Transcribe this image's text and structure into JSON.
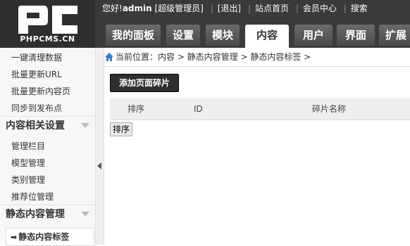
{
  "logo": {
    "text": "PHPCMS.CN"
  },
  "topbar": {
    "greeting": "您好!",
    "username": "admin",
    "role": "[超级管理员]",
    "logout": "[退出]",
    "site_home": "站点首页",
    "member_center": "会员中心",
    "search": "搜索"
  },
  "nav": {
    "tabs": [
      {
        "label": "我的面板"
      },
      {
        "label": "设置"
      },
      {
        "label": "模块"
      },
      {
        "label": "内容",
        "active": true
      },
      {
        "label": "用户"
      },
      {
        "label": "界面"
      },
      {
        "label": "扩展"
      }
    ]
  },
  "sidebar": {
    "items_top": [
      "一键清理数据",
      "批量更新URL",
      "批量更新内容页",
      "同步到发布点"
    ],
    "group1": {
      "title": "内容相关设置",
      "items": [
        "管理栏目",
        "模型管理",
        "类别管理",
        "推荐位管理"
      ]
    },
    "group2": {
      "title": "静态内容管理",
      "active_item": "静态内容标签"
    }
  },
  "breadcrumb": {
    "text": "当前位置：内容 > 静态内容管理 > 静态内容标签 >"
  },
  "main": {
    "add_button": "添加页面碎片",
    "columns": [
      "排序",
      "ID",
      "碎片名称"
    ],
    "sort_button": "排序"
  },
  "colors": {
    "header_bg": "#3a3a3a",
    "tab_bg": "#5a5a5a",
    "active_tab_bg": "#ffffff",
    "button_bg": "#2e2e2e"
  }
}
